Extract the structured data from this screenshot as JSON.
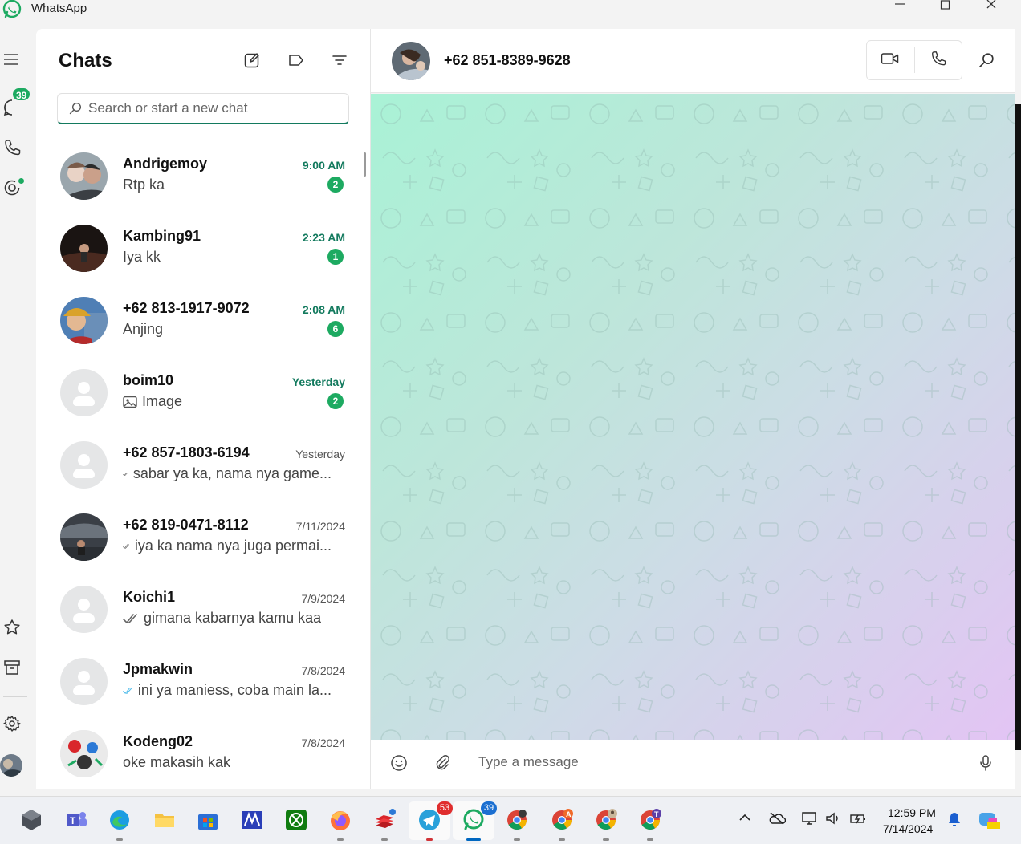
{
  "window": {
    "title": "WhatsApp"
  },
  "rail": {
    "chats_badge": "39"
  },
  "panel": {
    "title": "Chats",
    "search_placeholder": "Search or start a new chat"
  },
  "chats": [
    {
      "name": "Andrigemoy",
      "preview": "Rtp ka",
      "time": "9:00 AM",
      "unread": "2",
      "tick": "",
      "avatar": "photo"
    },
    {
      "name": "Kambing91",
      "preview": "Iya kk",
      "time": "2:23 AM",
      "unread": "1",
      "tick": "",
      "avatar": "photo"
    },
    {
      "name": "+62 813-1917-9072",
      "preview": "Anjing",
      "time": "2:08 AM",
      "unread": "6",
      "tick": "",
      "avatar": "photo"
    },
    {
      "name": "boim10",
      "preview": "Image",
      "time": "Yesterday",
      "unread": "2",
      "tick": "image",
      "avatar": "default"
    },
    {
      "name": "+62 857-1803-6194",
      "preview": "sabar ya ka, nama nya game...",
      "time": "Yesterday",
      "unread": "",
      "tick": "grey",
      "avatar": "default"
    },
    {
      "name": "+62 819-0471-8112",
      "preview": "iya ka nama nya juga permai...",
      "time": "7/11/2024",
      "unread": "",
      "tick": "grey",
      "avatar": "photo"
    },
    {
      "name": "Koichi1",
      "preview": "gimana kabarnya kamu kaa",
      "time": "7/9/2024",
      "unread": "",
      "tick": "grey",
      "avatar": "default"
    },
    {
      "name": "Jpmakwin",
      "preview": "ini ya maniess, coba main la...",
      "time": "7/8/2024",
      "unread": "",
      "tick": "blue",
      "avatar": "default"
    },
    {
      "name": "Kodeng02",
      "preview": "oke makasih kak",
      "time": "7/8/2024",
      "unread": "",
      "tick": "",
      "avatar": "photo"
    }
  ],
  "conversation": {
    "contact": "+62 851-8389-9628",
    "composer_placeholder": "Type a message"
  },
  "taskbar": {
    "telegram_badge": "53",
    "whatsapp_badge": "39",
    "chrome_profile_a": "A",
    "chrome_profile_t": "T",
    "time": "12:59 PM",
    "date": "7/14/2024"
  },
  "colors": {
    "accent": "#1daa61",
    "accent_dark": "#137a5e",
    "read_tick": "#53bdeb"
  }
}
